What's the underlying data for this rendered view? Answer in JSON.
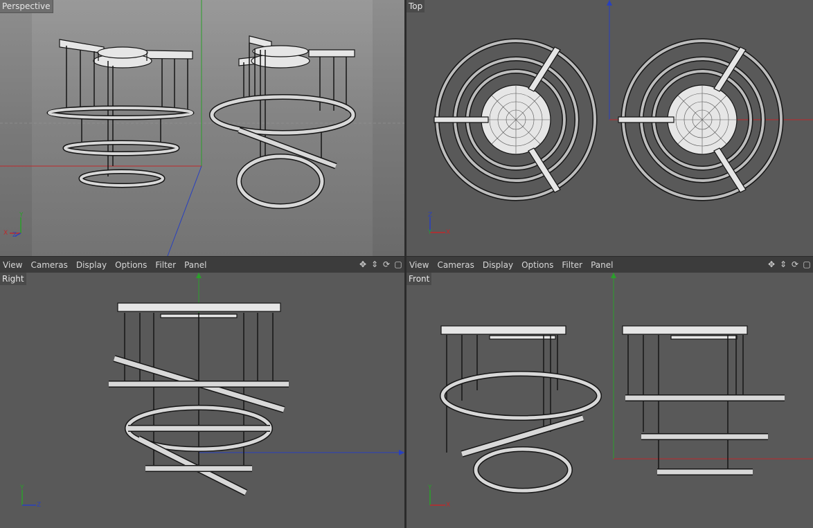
{
  "viewports": {
    "perspective": {
      "label": "Perspective"
    },
    "top": {
      "label": "Top"
    },
    "right": {
      "label": "Right"
    },
    "front": {
      "label": "Front"
    }
  },
  "menu": [
    "View",
    "Cameras",
    "Display",
    "Options",
    "Filter",
    "Panel"
  ],
  "nav_icons": [
    "move-icon",
    "zoom-icon",
    "rotate-icon",
    "maximize-icon"
  ],
  "axis_gizmo": {
    "perspective": [
      "Y",
      "X",
      "Z"
    ],
    "top": [
      "Z",
      "Y",
      "X"
    ],
    "right": [
      "Y",
      "Z"
    ],
    "front": [
      "Y",
      "X"
    ]
  },
  "colors": {
    "axis_x": "#c0282a",
    "axis_y": "#2aa02a",
    "axis_z": "#2840c0",
    "wire": "#151515",
    "mesh_fill": "#e6e6e6",
    "viewport_bg": "#595959",
    "menubar_bg": "#3c3c3c"
  }
}
